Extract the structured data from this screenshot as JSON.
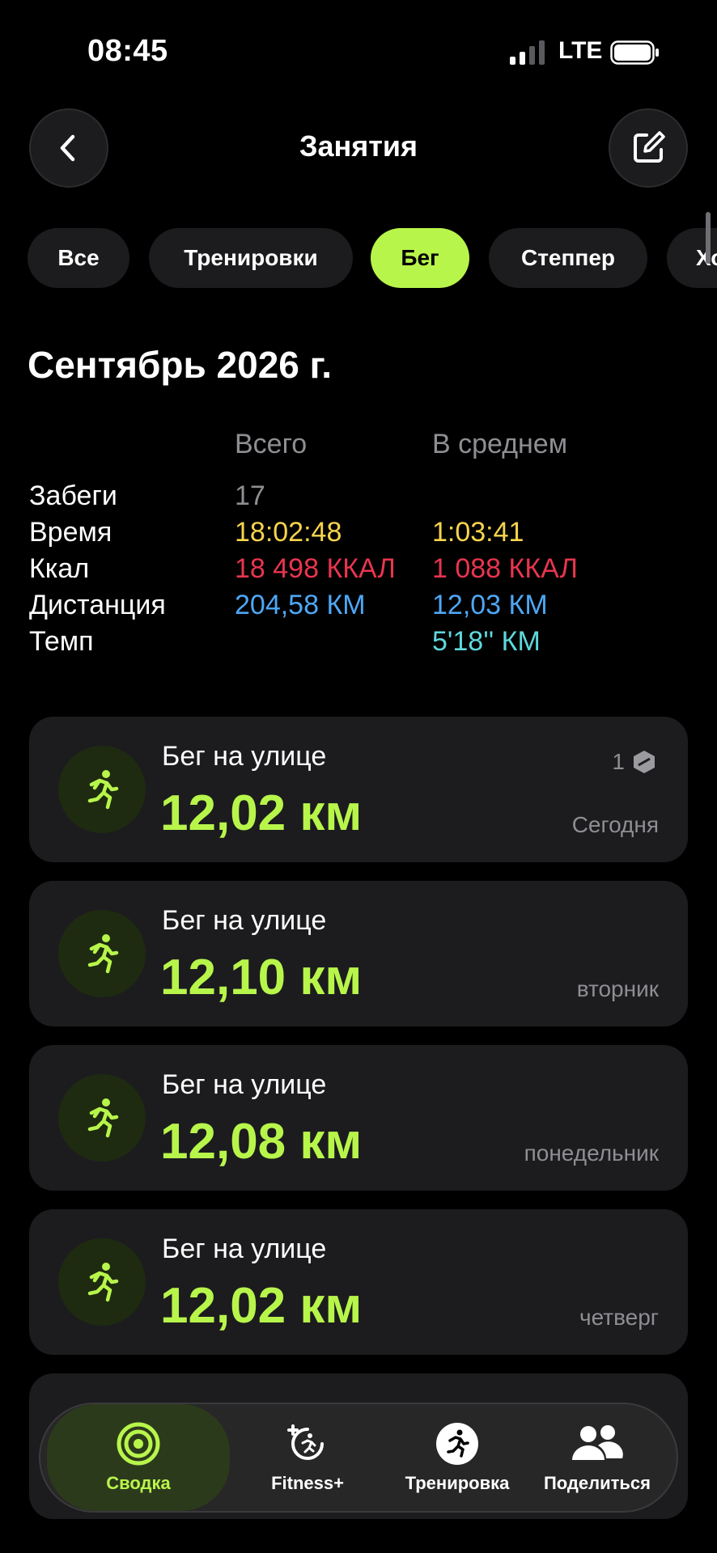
{
  "status": {
    "time": "08:45",
    "network": "LTE"
  },
  "nav": {
    "title": "Занятия",
    "back_icon": "chevron-left-icon",
    "edit_icon": "compose-icon"
  },
  "filters": [
    {
      "label": "Все",
      "active": false
    },
    {
      "label": "Тренировки",
      "active": false
    },
    {
      "label": "Бег",
      "active": true
    },
    {
      "label": "Степпер",
      "active": false
    },
    {
      "label": "Хо",
      "active": false
    }
  ],
  "summary": {
    "month": "Сентябрь 2026 г.",
    "col_total": "Всего",
    "col_avg": "В среднем",
    "rows": {
      "runs": {
        "label": "Забеги",
        "total": "17",
        "avg": ""
      },
      "time": {
        "label": "Время",
        "total": "18:02:48",
        "avg": "1:03:41"
      },
      "kcal": {
        "label": "Ккал",
        "total": "18 498 ККАЛ",
        "avg": "1 088 ККАЛ"
      },
      "distance": {
        "label": "Дистанция",
        "total": "204,58 КМ",
        "avg": "12,03 КМ"
      },
      "pace": {
        "label": "Темп",
        "total": "",
        "avg": "5'18'' КМ"
      }
    },
    "colors": {
      "time": "#f7d44c",
      "kcal": "#e8354f",
      "distance": "#4ea7f5",
      "pace": "#5fd8dc"
    }
  },
  "workouts": [
    {
      "name": "Бег на улице",
      "distance": "12,02 км",
      "day": "Сегодня",
      "badge_count": "1"
    },
    {
      "name": "Бег на улице",
      "distance": "12,10 км",
      "day": "вторник"
    },
    {
      "name": "Бег на улице",
      "distance": "12,08 км",
      "day": "понедельник"
    },
    {
      "name": "Бег на улице",
      "distance": "12,02 км",
      "day": "четверг"
    }
  ],
  "tabbar": {
    "summary": "Сводка",
    "fitness": "Fitness+",
    "workout": "Тренировка",
    "share": "Поделиться"
  },
  "accent": "#b8f54b"
}
